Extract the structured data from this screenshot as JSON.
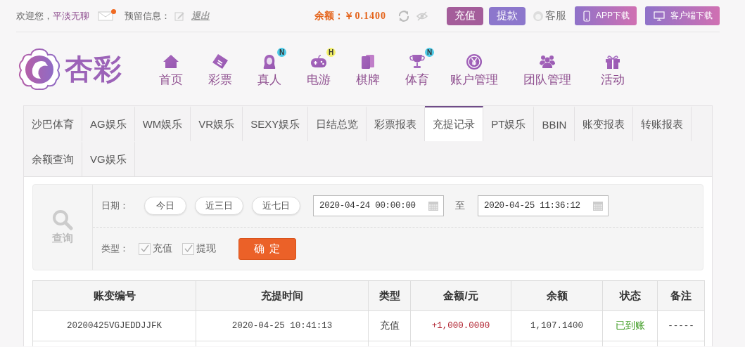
{
  "top_bar": {
    "welcome": "欢迎您，",
    "username": "平淡无聊",
    "message_unread": true,
    "reserved_info_label": "预留信息：",
    "logout": "退出",
    "balance_label": "余额：",
    "balance": "￥0.1400",
    "buttons": [
      {
        "label": "充值",
        "kind": "deposit"
      },
      {
        "label": "提款",
        "kind": "withdraw"
      }
    ],
    "service": "客服",
    "downloads": [
      {
        "label": "APP下载",
        "kind": "phone"
      },
      {
        "label": "客户端下载",
        "kind": "desktop"
      }
    ]
  },
  "logo": {
    "text": "杏彩"
  },
  "nav": [
    {
      "label": "首页",
      "kind": "home"
    },
    {
      "label": "彩票",
      "kind": "ticket"
    },
    {
      "label": "真人",
      "kind": "figure",
      "badge": "N"
    },
    {
      "label": "电游",
      "kind": "gamepad",
      "badge": "H"
    },
    {
      "label": "棋牌",
      "kind": "cards"
    },
    {
      "label": "体育",
      "kind": "trophy",
      "badge": "N"
    },
    {
      "label": "账户管理",
      "kind": "coin"
    },
    {
      "label": "团队管理",
      "kind": "people"
    },
    {
      "label": "活动",
      "kind": "gift"
    }
  ],
  "tabs": [
    {
      "label": "沙巴体育",
      "selected": false
    },
    {
      "label": "AG娱乐",
      "selected": false
    },
    {
      "label": "WM娱乐",
      "selected": false
    },
    {
      "label": "VR娱乐",
      "selected": false
    },
    {
      "label": "SEXY娱乐",
      "selected": false
    },
    {
      "label": "日结总览",
      "selected": false
    },
    {
      "label": "彩票报表",
      "selected": false
    },
    {
      "label": "充提记录",
      "selected": true
    },
    {
      "label": "PT娱乐",
      "selected": false
    },
    {
      "label": "BBIN",
      "selected": false
    },
    {
      "label": "账变报表",
      "selected": false
    },
    {
      "label": "转账报表",
      "selected": false
    },
    {
      "label": "余额查询",
      "selected": false
    },
    {
      "label": "VG娱乐",
      "selected": false
    }
  ],
  "query": {
    "icon_label": "查询",
    "date_label": "日期：",
    "quick_ranges": [
      "今日",
      "近三日",
      "近七日"
    ],
    "start": "2020-04-24 00:00:00",
    "to": "至",
    "end": "2020-04-25 11:36:12",
    "type_label": "类型：",
    "types": [
      {
        "label": "充值",
        "checked": true
      },
      {
        "label": "提现",
        "checked": true
      }
    ],
    "submit": "确 定"
  },
  "table": {
    "columns": [
      "账变编号",
      "充提时间",
      "类型",
      "金额/元",
      "余额",
      "状态",
      "备注"
    ],
    "rows": [
      [
        "20200425VGJEDDJJFK",
        "2020-04-25 10:41:13",
        "充值",
        "+1,000.0000",
        "1,107.1400",
        "已到账",
        "-----"
      ]
    ]
  }
}
